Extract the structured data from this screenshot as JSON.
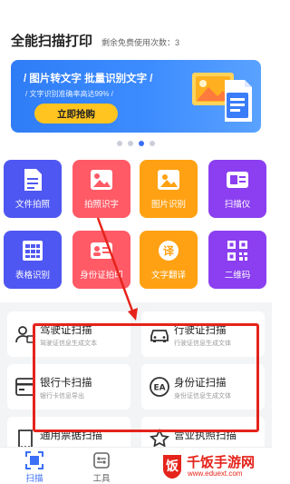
{
  "header": {
    "title": "全能扫描打印",
    "remaining": "剩余免费使用次数：3"
  },
  "banner": {
    "title": "/ 图片转文字  批量识别文字 /",
    "subtitle": "/ 文字识别准确率高达99% /",
    "cta": "立即抢购"
  },
  "carousel": {
    "count": 4,
    "active": 2
  },
  "tools": [
    {
      "label": "文件拍照",
      "icon": "document-icon",
      "color": "#4f57f2"
    },
    {
      "label": "拍照识字",
      "icon": "image-text-icon",
      "color": "#ff5a66"
    },
    {
      "label": "图片识别",
      "icon": "image-icon",
      "color": "#ffa112"
    },
    {
      "label": "扫描仪",
      "icon": "scanner-icon",
      "color": "#8b3ff0"
    },
    {
      "label": "表格识别",
      "icon": "table-icon",
      "color": "#4f57f2"
    },
    {
      "label": "身份证拍印",
      "icon": "id-card-icon",
      "color": "#ff5a66"
    },
    {
      "label": "文字翻译",
      "icon": "translate-icon",
      "color": "#ffa112"
    },
    {
      "label": "二维码",
      "icon": "qrcode-icon",
      "color": "#8b3ff0"
    }
  ],
  "cards": [
    {
      "title": "驾驶证扫描",
      "subtitle": "驾驶证信息生成文本",
      "icon": "driver-license-icon"
    },
    {
      "title": "行驶证扫描",
      "subtitle": "行驶证信息生成文体",
      "icon": "car-icon"
    },
    {
      "title": "银行卡扫描",
      "subtitle": "银行卡信息导出",
      "icon": "bank-card-icon"
    },
    {
      "title": "身份证扫描",
      "subtitle": "身份证信息生成文体",
      "icon": "id-scan-icon"
    },
    {
      "title": "通用票据扫描",
      "subtitle": "",
      "icon": "receipt-icon"
    },
    {
      "title": "营业执照扫描",
      "subtitle": "",
      "icon": "license-icon"
    }
  ],
  "tabbar": [
    {
      "label": "扫描",
      "icon": "scan-icon",
      "active": true,
      "color": "#3b6ff5"
    },
    {
      "label": "工具",
      "icon": "tools-icon",
      "active": false,
      "color": "#666666"
    }
  ],
  "watermark": {
    "name": "千饭手游网",
    "url": "www.eduext.com",
    "color": "#e5231b"
  }
}
